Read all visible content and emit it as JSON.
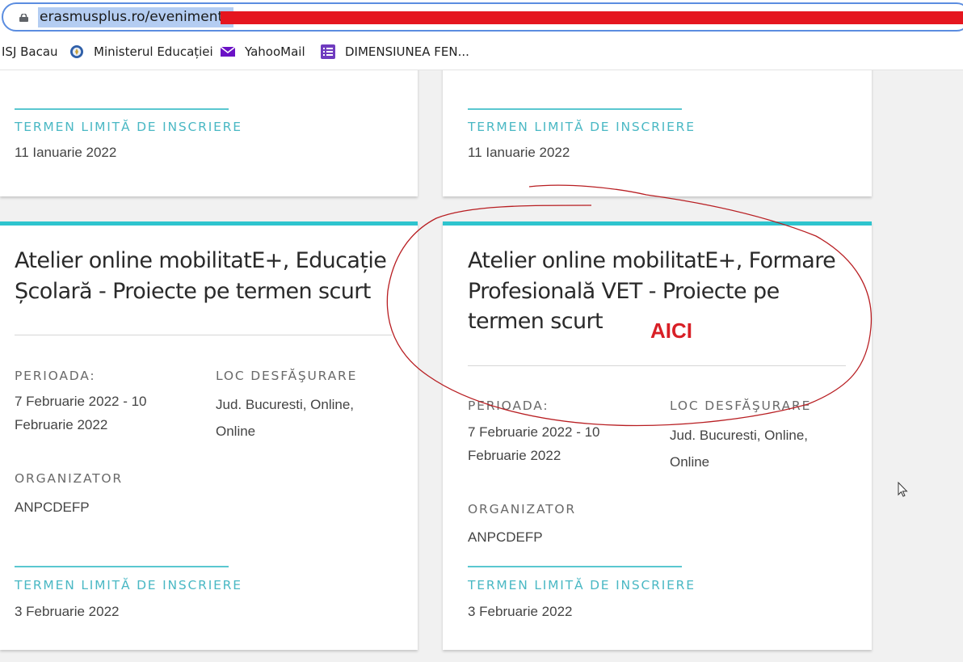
{
  "browser": {
    "url": "erasmusplus.ro/evenimente",
    "bookmarks": [
      {
        "label": "ISJ Bacau",
        "icon": "none"
      },
      {
        "label": "Ministerul Educației",
        "icon": "ministry-seal-icon"
      },
      {
        "label": "YahooMail",
        "icon": "mail-envelope-icon"
      },
      {
        "label": "DIMENSIUNEA FEN...",
        "icon": "form-list-icon"
      }
    ],
    "colors": {
      "focus_border": "#5b8de0",
      "selection": "#b4cdf2",
      "redaction": "#e5161f"
    }
  },
  "labels": {
    "deadline": "TERMEN LIMITĂ DE INSCRIERE",
    "period": "PERIOADA:",
    "location": "LOC DESFĂŞURARE",
    "organizer": "ORGANIZATOR"
  },
  "top_cards": [
    {
      "deadline": "11 Ianuarie 2022"
    },
    {
      "deadline": "11 Ianuarie 2022"
    }
  ],
  "events": [
    {
      "title_lines": [
        "Atelier online mobilitatE+, Educație",
        "Școlară - Proiecte pe termen scurt"
      ],
      "period_lines": [
        "7 Februarie 2022 - 10",
        "Februarie 2022"
      ],
      "location_lines": [
        "Jud. Bucuresti, Online,",
        "Online"
      ],
      "organizer": "ANPCDEFP",
      "deadline": "3 Februarie 2022"
    },
    {
      "title_lines": [
        "Atelier online mobilitatE+, Formare",
        "Profesională VET - Proiecte pe",
        "termen scurt"
      ],
      "period_lines": [
        "7 Februarie 2022 - 10",
        "Februarie 2022"
      ],
      "location_lines": [
        "Jud. Bucuresti, Online,",
        "Online"
      ],
      "organizer": "ANPCDEFP",
      "deadline": "3 Februarie 2022"
    }
  ],
  "annotation": {
    "text": "AICI",
    "color": "#d81f26"
  },
  "theme": {
    "accent": "#2ec4ce",
    "label_accent": "#4ab8c4"
  }
}
